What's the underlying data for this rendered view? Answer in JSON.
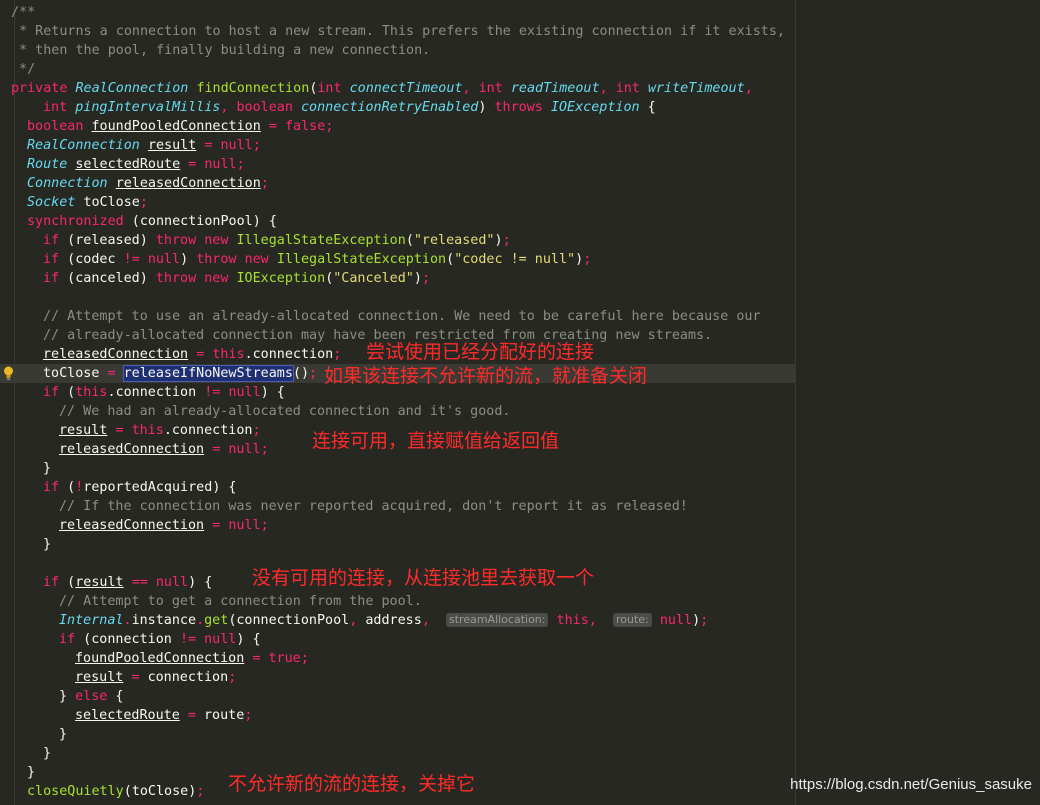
{
  "code": {
    "doc_comment": [
      "/**",
      " * Returns a connection to host a new stream. This prefers the existing connection if it exists,",
      " * then the pool, finally building a new connection.",
      " */"
    ],
    "kw_private": "private",
    "kw_int": "int",
    "kw_boolean": "boolean",
    "kw_throws": "throws",
    "kw_synchronized": "synchronized",
    "kw_if": "if",
    "kw_throw": "throw",
    "kw_new": "new",
    "kw_this": "this",
    "kw_null": "null",
    "kw_false": "false",
    "kw_true": "true",
    "kw_else": "else",
    "type_real_connection": "RealConnection",
    "type_route": "Route",
    "type_connection": "Connection",
    "type_socket": "Socket",
    "type_io_exception": "IOException",
    "type_illegal_state": "IllegalStateException",
    "type_internal": "Internal",
    "method_find_connection": "findConnection",
    "param_connect_timeout": "connectTimeout",
    "param_read_timeout": "readTimeout",
    "param_write_timeout": "writeTimeout",
    "param_ping_interval": "pingIntervalMillis",
    "param_retry_enabled": "connectionRetryEnabled",
    "var_found_pooled": "foundPooledConnection",
    "var_result": "result",
    "var_selected_route": "selectedRoute",
    "var_released_connection": "releasedConnection",
    "var_to_close": "toClose",
    "field_connection_pool": "connectionPool",
    "field_released": "released",
    "field_codec": "codec",
    "field_canceled": "canceled",
    "field_connection": "connection",
    "field_reported_acquired": "reportedAcquired",
    "field_instance": "instance",
    "field_address": "address",
    "field_route": "route",
    "str_released": "\"released\"",
    "str_codec": "\"codec != null\"",
    "str_canceled": "\"Canceled\"",
    "method_release_if": "releaseIfNoNewStreams",
    "method_get": "get",
    "method_close_quietly": "closeQuietly",
    "comment_attempt_1": "// Attempt to use an already-allocated connection. We need to be careful here because our",
    "comment_attempt_2": "// already-allocated connection may have been restricted from creating new streams.",
    "comment_had_allocated": "// We had an already-allocated connection and it's good.",
    "comment_never_reported": "// If the connection was never reported acquired, don't report it as released!",
    "comment_attempt_pool": "// Attempt to get a connection from the pool.",
    "hint_stream_allocation": "streamAllocation:",
    "hint_route": "route:"
  },
  "annotations": {
    "try_allocated": "尝试使用已经分配好的连接",
    "prepare_close": "如果该连接不允许新的流，就准备关闭",
    "connection_available": "连接可用，直接赋值给返回值",
    "get_from_pool": "没有可用的连接，从连接池里去获取一个",
    "close_it": "不允许新的流的连接，关掉它"
  },
  "watermark": "https://blog.csdn.net/Genius_sasuke",
  "icons": {
    "intention_bulb": "lightbulb-icon"
  },
  "colors": {
    "background": "#272822",
    "keyword": "#f92672",
    "type": "#66d9ef",
    "method": "#a6e22e",
    "string": "#e6db74",
    "comment": "#8a8f82",
    "annotation": "#ff2b2b"
  }
}
